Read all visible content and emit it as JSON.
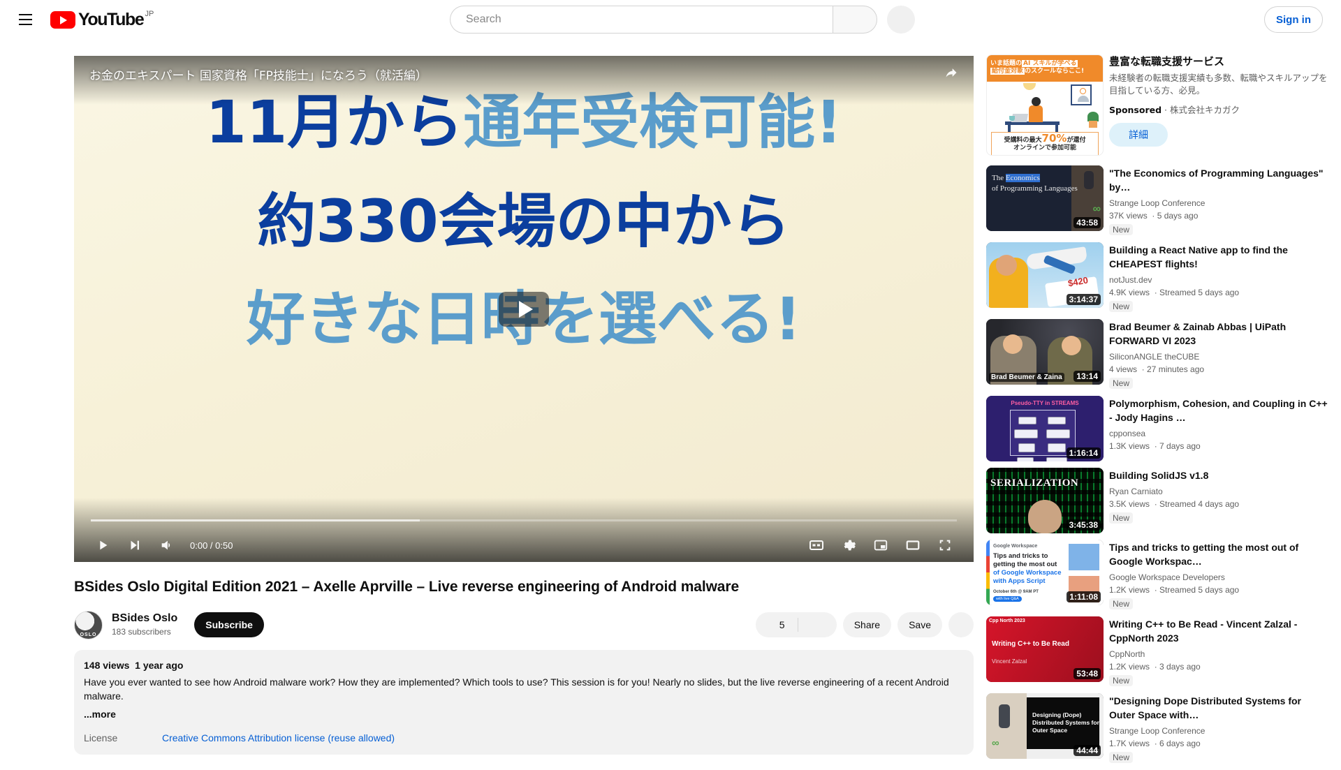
{
  "header": {
    "menu_icon": "hamburger-icon",
    "logo_text": "YouTube",
    "logo_country": "JP",
    "search_placeholder": "Search",
    "search_value": "",
    "search_icon": "search-icon",
    "mic_icon": "microphone-icon",
    "sign_in_label": "Sign in"
  },
  "player": {
    "ad_overlay_title": "お金のエキスパート 国家資格「FP技能士」になろう（就活編）",
    "share_icon": "share-icon",
    "ad_line1_a": "11月から",
    "ad_line1_b": "通年受検可能!",
    "ad_line2": "約330会場の中から",
    "ad_line3": "好きな日時を選べる!",
    "play_icon": "play-icon",
    "next_icon": "next-track-icon",
    "mute_icon": "volume-icon",
    "time_display": "0:00 / 0:50",
    "cc_icon": "closed-captions-icon",
    "settings_icon": "gear-icon",
    "miniplayer_icon": "miniplayer-icon",
    "theater_icon": "theater-mode-icon",
    "fullscreen_icon": "fullscreen-icon"
  },
  "video": {
    "title": "BSides Oslo Digital Edition 2021 – Axelle Aprville – Live reverse engineering of Android malware",
    "channel_name": "BSides Oslo",
    "channel_subs": "183 subscribers",
    "avatar_text": "OSLO",
    "subscribe_label": "Subscribe",
    "like_count": "5",
    "like_icon": "thumbs-up-icon",
    "dislike_icon": "thumbs-down-icon",
    "share_label": "Share",
    "save_label": "Save",
    "more_label": "...",
    "views": "148 views",
    "published": "1 year ago",
    "description": "Have you ever wanted to see how Android malware work? How they are implemented? Which tools to use? This session is for you! Nearly no slides, but the live reverse engineering of a recent Android malware.",
    "more_link": "...more",
    "license_label": "License",
    "license_value": "Creative Commons Attribution license (reuse allowed)"
  },
  "sponsored": {
    "thumb_band_a": "いま話題の",
    "thumb_band_ai": "AI スキルが学べる",
    "thumb_band_b": "給付金対象",
    "thumb_band_c": "のスクールならここ!",
    "thumb_foot_a": "受講料の最大",
    "thumb_foot_big": "70%",
    "thumb_foot_b": "が還付",
    "thumb_foot_c": "オンラインで参加可能",
    "title": "豊富な転職支援サービス",
    "description": "未経験者の転職支援実績も多数、転職やスキルアップを目指している方、必見。",
    "sponsored_label": "Sponsored",
    "advertiser": "株式会社キカガク",
    "cta_label": "詳細"
  },
  "sidebar_videos": [
    {
      "title": "\"The Economics of Programming Languages\" by…",
      "channel": "Strange Loop Conference",
      "views": "37K views",
      "age": "5 days ago",
      "duration": "43:58",
      "badge": "New",
      "thumb_class": "th-econ",
      "thumb_text_1": "The ",
      "thumb_text_hl": "Economics",
      "thumb_text_2": "of Programming Languages"
    },
    {
      "title": "Building a React Native app to find the CHEAPEST flights!",
      "channel": "notJust.dev",
      "views": "4.9K views",
      "age": "Streamed 5 days ago",
      "duration": "3:14:37",
      "badge": "New",
      "thumb_class": "th-react",
      "thumb_price": "$420"
    },
    {
      "title": "Brad Beumer & Zainab Abbas | UiPath FORWARD VI 2023",
      "channel": "SiliconANGLE theCUBE",
      "views": "4 views",
      "age": "27 minutes ago",
      "duration": "13:14",
      "badge": "New",
      "thumb_class": "th-cube",
      "thumb_overlay": "Brad Beumer & Zaina"
    },
    {
      "title": "Polymorphism, Cohesion, and Coupling in C++ - Jody Hagins …",
      "channel": "cpponsea",
      "views": "1.3K views",
      "age": "7 days ago",
      "duration": "1:16:14",
      "badge": "",
      "thumb_class": "th-poly",
      "thumb_label": "Pseudo-TTY in STREAMS"
    },
    {
      "title": "Building SolidJS v1.8",
      "channel": "Ryan Carniato",
      "views": "3.5K views",
      "age": "Streamed 4 days ago",
      "duration": "3:45:38",
      "badge": "New",
      "thumb_class": "th-ser",
      "thumb_label": "SERIALIZATION"
    },
    {
      "title": "Tips and tricks to getting the most out of Google Workspac…",
      "channel": "Google Workspace Developers",
      "views": "1.2K views",
      "age": "Streamed 5 days ago",
      "duration": "1:11:08",
      "badge": "New",
      "thumb_class": "th-gws",
      "thumb_brand": "Google Workspace",
      "thumb_t1": "Tips and tricks to getting the most out",
      "thumb_t2": "of Google Workspace with Apps Script",
      "thumb_date": "October 6th @ 9AM PT",
      "thumb_qa": "with live Q&A"
    },
    {
      "title": "Writing C++ to Be Read - Vincent Zalzal - CppNorth 2023",
      "channel": "CppNorth",
      "views": "1.2K views",
      "age": "3 days ago",
      "duration": "53:48",
      "badge": "New",
      "thumb_class": "th-cpp",
      "thumb_logo": "Cpp North 2023",
      "thumb_title": "Writing C++ to Be Read",
      "thumb_author": "Vincent Zalzal"
    },
    {
      "title": "\"Designing Dope Distributed Systems for Outer Space with…",
      "channel": "Strange Loop Conference",
      "views": "1.7K views",
      "age": "6 days ago",
      "duration": "44:44",
      "badge": "New",
      "thumb_class": "th-dope",
      "thumb_text": "Designing (Dope) Distributed Systems for Outer Space"
    }
  ]
}
